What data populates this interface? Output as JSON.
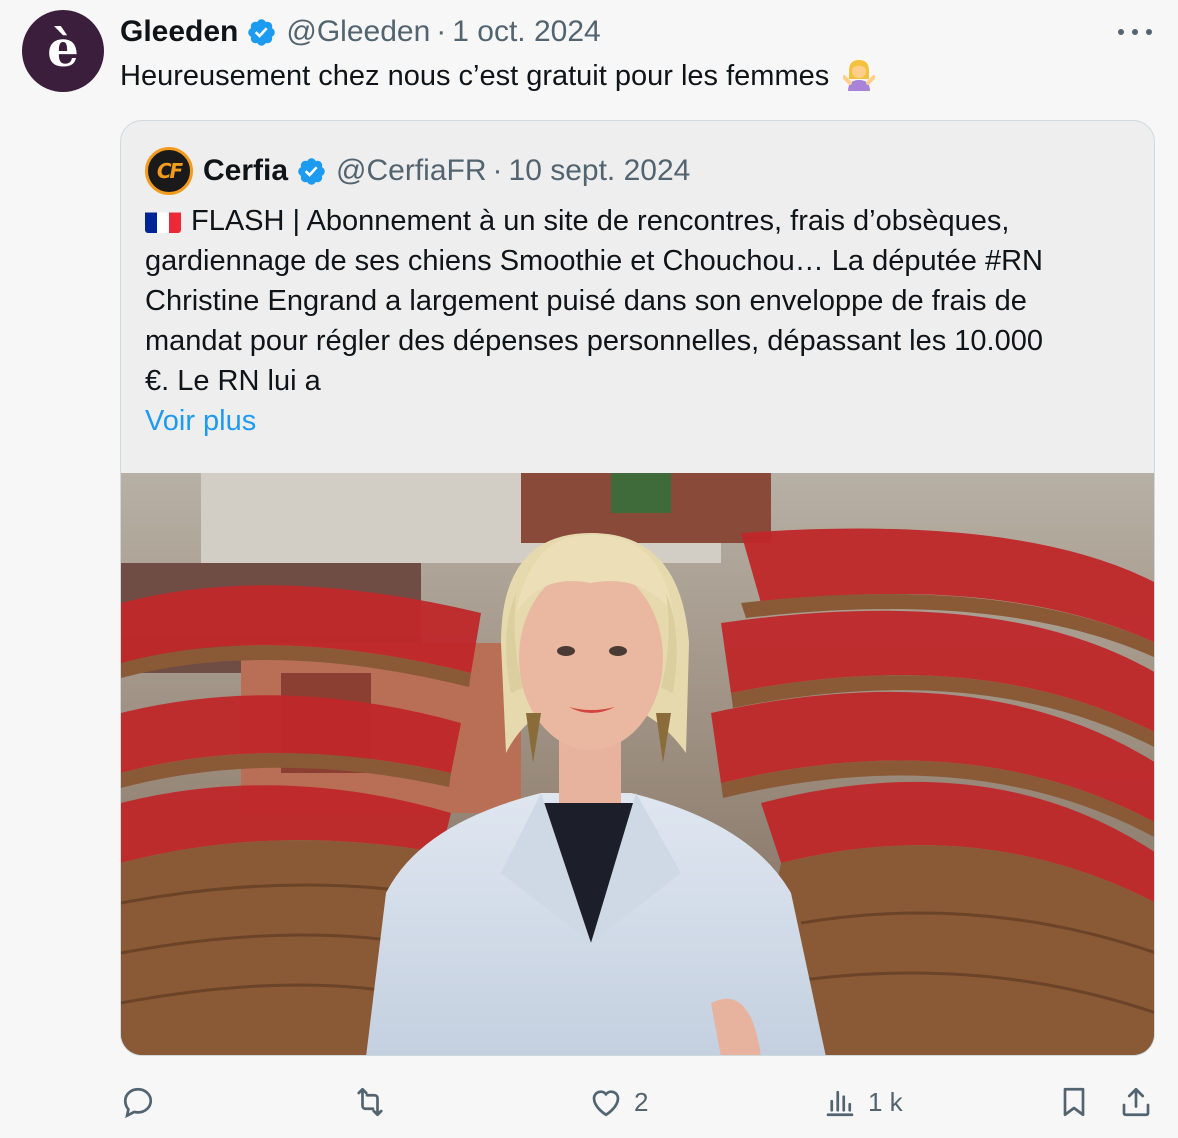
{
  "tweet": {
    "author_name": "Gleeden",
    "author_handle": "@Gleeden",
    "separator": "·",
    "date": "1 oct. 2024",
    "avatar_letter": "è",
    "text": "Heureusement chez nous c’est gratuit pour les femmes",
    "emoji": "person-shrugging-emoji"
  },
  "quote": {
    "author_name": "Cerfia",
    "author_handle": "@CerfiaFR",
    "separator": "·",
    "date": "10 sept. 2024",
    "avatar_text": "CF",
    "flag": "french-flag",
    "lines": [
      "FLASH | Abonnement à un site de rencontres, frais d’obsèques,",
      "gardiennage de ses chiens Smoothie et Chouchou… La députée #RN",
      "Christine Engrand a largement puisé dans son enveloppe de frais de",
      "mandat pour régler des dépenses personnelles, dépassant les 10.000",
      "€. Le RN lui a"
    ],
    "show_more": "Voir plus",
    "image": "photo-deputy-in-national-assembly"
  },
  "actions": {
    "reply": {
      "icon": "reply-icon",
      "count": ""
    },
    "repost": {
      "icon": "repost-icon",
      "count": ""
    },
    "like": {
      "icon": "heart-icon",
      "count": "2"
    },
    "views": {
      "icon": "views-icon",
      "count": "1 k"
    },
    "bookmark": {
      "icon": "bookmark-icon"
    },
    "share": {
      "icon": "share-icon"
    }
  },
  "colors": {
    "verified": "#1d9bf0",
    "link": "#1d9bf0",
    "muted": "#536471",
    "avatar_bg": "#3b1d3c"
  }
}
